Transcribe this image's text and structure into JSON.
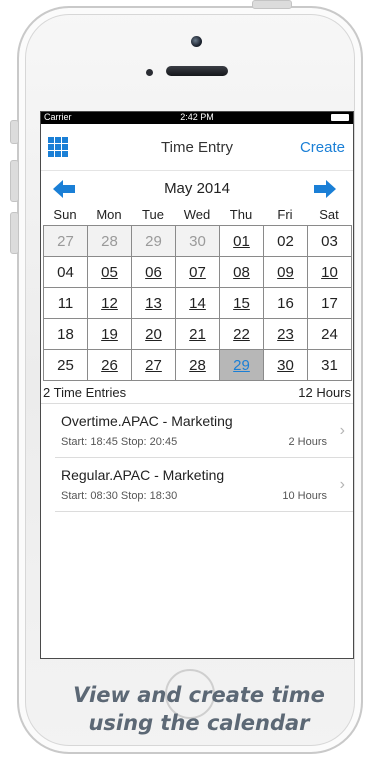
{
  "status_bar": {
    "carrier": "Carrier",
    "time": "2:42 PM"
  },
  "navbar": {
    "title": "Time Entry",
    "create_label": "Create",
    "menu_icon": "grid-icon"
  },
  "calendar": {
    "month_label": "May 2014",
    "prev_icon": "arrow-left-icon",
    "next_icon": "arrow-right-icon",
    "weekdays": [
      "Sun",
      "Mon",
      "Tue",
      "Wed",
      "Thu",
      "Fri",
      "Sat"
    ],
    "weeks": [
      [
        "27",
        "28",
        "29",
        "30",
        "01",
        "02",
        "03"
      ],
      [
        "04",
        "05",
        "06",
        "07",
        "08",
        "09",
        "10"
      ],
      [
        "11",
        "12",
        "13",
        "14",
        "15",
        "16",
        "17"
      ],
      [
        "18",
        "19",
        "20",
        "21",
        "22",
        "23",
        "24"
      ],
      [
        "25",
        "26",
        "27",
        "28",
        "29",
        "30",
        "31"
      ]
    ],
    "selected_day": "29"
  },
  "summary": {
    "count_label": "2 Time Entries",
    "total_label": "12 Hours"
  },
  "entries": [
    {
      "title": "Overtime.APAC - Marketing",
      "times": "Start: 18:45 Stop: 20:45",
      "hours": "2 Hours"
    },
    {
      "title": "Regular.APAC - Marketing",
      "times": "Start: 08:30 Stop: 18:30",
      "hours": "10 Hours"
    }
  ],
  "caption": {
    "line1": "View  and create time",
    "line2": "using the calendar"
  },
  "colors": {
    "accent": "#1a7fd6",
    "selected_cell": "#b7b7b7",
    "other_month": "#9a9a9a",
    "caption": "#5c6875"
  }
}
